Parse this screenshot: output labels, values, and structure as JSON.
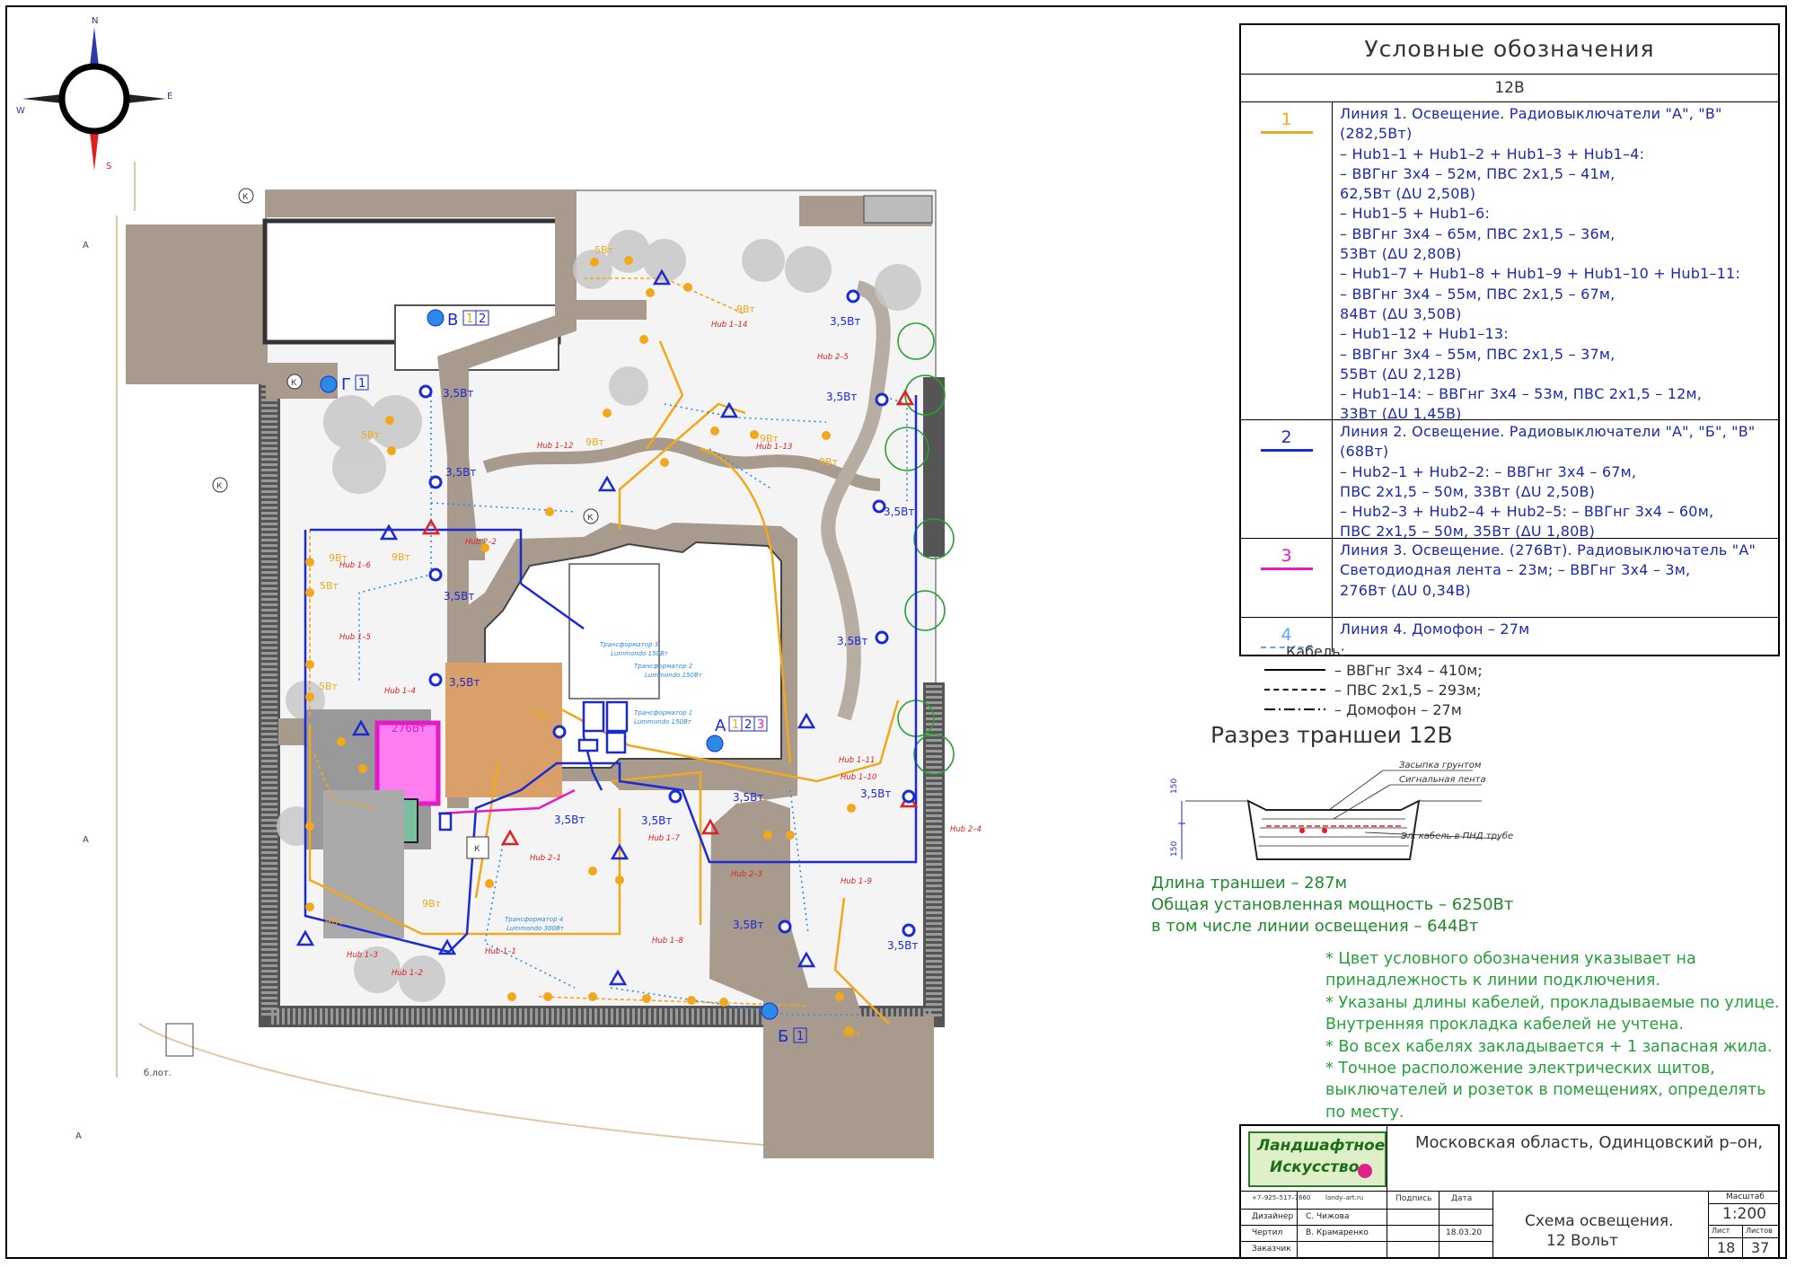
{
  "compass": {
    "n": "N",
    "e": "E",
    "s": "S",
    "w": "W"
  },
  "legend": {
    "title": "Условные обозначения",
    "voltage": "12В",
    "lines": [
      {
        "num": "1",
        "color": "#f2a81d",
        "style": "solid",
        "text": [
          "Линия 1. Освещение. Радиовыключатели \"А\", \"В\"",
          "(282,5Вт)",
          "– Hub1–1 + Hub1–2 + Hub1–3 + Hub1–4:",
          "– ВВГнг 3х4 – 52м, ПВС 2х1,5 – 41м,",
          "   62,5Вт (ΔU 2,50В)",
          "– Hub1–5 + Hub1–6:",
          "– ВВГнг 3х4 – 65м, ПВС 2х1,5 – 36м,",
          "   53Вт (ΔU 2,80В)",
          "– Hub1–7 + Hub1–8 + Hub1–9 + Hub1–10 + Hub1–11:",
          "– ВВГнг 3х4 – 55м, ПВС 2х1,5 – 67м,",
          "   84Вт (ΔU 3,50В)",
          "– Hub1–12 + Hub1–13:",
          "– ВВГнг 3х4 – 55м, ПВС 2х1,5 – 37м,",
          "   55Вт (ΔU 2,12В)",
          "– Hub1–14: – ВВГнг 3х4 – 53м, ПВС 2х1,5 – 12м,",
          "   33Вт (ΔU 1,45В)"
        ]
      },
      {
        "num": "2",
        "color": "#1a2ad6",
        "style": "solid",
        "text": [
          "Линия 2. Освещение. Радиовыключатели \"А\", \"Б\", \"В\"",
          "(68Вт)",
          "– Hub2–1 + Hub2–2: – ВВГнг 3х4 – 67м,",
          "   ПВС 2х1,5 – 50м, 33Вт (ΔU 2,50В)",
          "– Hub2–3 + Hub2–4 + Hub2–5: – ВВГнг 3х4 – 60м,",
          "   ПВС 2х1,5 – 50м, 35Вт (ΔU 1,80В)"
        ]
      },
      {
        "num": "3",
        "color": "#e21ac8",
        "style": "solid",
        "text": [
          "Линия 3. Освещение. (276Вт). Радиовыключатель \"А\"",
          "Светодиодная лента – 23м; – ВВГнг 3х4 – 3м,",
          "276Вт (ΔU 0,34В)"
        ]
      },
      {
        "num": "4",
        "color": "#5aaaf0",
        "style": "dashed",
        "text": [
          "Линия 4. Домофон – 27м"
        ]
      }
    ]
  },
  "cables": {
    "heading": "Кабель:",
    "items": [
      {
        "style": "solid",
        "text": "– ВВГнг 3х4 – 410м;"
      },
      {
        "style": "dashed",
        "text": "– ПВС 2х1,5 – 293м;"
      },
      {
        "style": "dashdot",
        "text": "– Домофон – 27м"
      }
    ]
  },
  "trench": {
    "title": "Разрез траншеи 12В",
    "labels": [
      "Засыпка грунтом",
      "Сигнальная лента",
      "Эл. кабель в ПНД трубе"
    ],
    "dims": [
      "150",
      "150"
    ]
  },
  "stats": [
    "Длина траншеи – 287м",
    "Общая установленная мощность – 6250Вт",
    "в том числе линии освещения – 644Вт"
  ],
  "notes": [
    "* Цвет условного обозначения указывает на",
    "принадлежность к линии подключения.",
    "* Указаны длины кабелей, прокладываемые по улице.",
    "Внутренняя прокладка кабелей не учтена.",
    "* Во всех кабелях закладывается + 1 запасная жила.",
    "* Точное расположение электрических щитов,",
    "выключателей и розеток в помещениях, определять",
    "по месту."
  ],
  "title_block": {
    "logo_line1": "Ландшафтное",
    "logo_line2": "Искусство",
    "address": "Московская область, Одинцовский р–он,",
    "contacts": [
      "+7–925–517–7660",
      "landy–art.ru"
    ],
    "sign_header": "Подпись",
    "date_header": "Дата",
    "roles": [
      {
        "role": "Дизайнер",
        "name": "С. Чижова",
        "date": ""
      },
      {
        "role": "Чертил",
        "name": "В. Крамаренко",
        "date": "18.03.20"
      },
      {
        "role": "Заказчик",
        "name": "",
        "date": ""
      }
    ],
    "sheet_title_1": "Схема освещения.",
    "sheet_title_2": "12 Вольт",
    "scale_label": "Масштаб",
    "scale": "1:200",
    "sheet_label": "Лист",
    "sheets_label": "Листов",
    "sheet": "18",
    "sheets": "37"
  },
  "plan": {
    "switch_labels": [
      {
        "letter": "В",
        "nums": [
          "1",
          "2"
        ]
      },
      {
        "letter": "Г",
        "nums": [
          "1"
        ]
      },
      {
        "letter": "А",
        "nums": [
          "1",
          "2",
          "3"
        ]
      },
      {
        "letter": "Б",
        "nums": [
          "1"
        ]
      }
    ],
    "hubs": [
      "Hub 1–14",
      "Hub 2–5",
      "Hub 1–12",
      "Hub 1–13",
      "Hub 2–2",
      "Hub 1–6",
      "Hub 1–5",
      "Hub 1–4",
      "Hub 2–1",
      "Hub 1–7",
      "Hub 1–11",
      "Hub 1–10",
      "Hub 2–4",
      "Hub 2–3",
      "Hub 1–9",
      "Hub 1–8",
      "Hub 1–3",
      "Hub 1–2",
      "Hub 1–1"
    ],
    "transformers": [
      {
        "name": "Трансформатор 3",
        "model": "Lummondo 150Вт"
      },
      {
        "name": "Трансформатор 2",
        "model": "Lummondo 150Вт"
      },
      {
        "name": "Трансформатор 1",
        "model": "Lummondo 150Вт"
      },
      {
        "name": "Трансформатор 4",
        "model": "Lummondo 300Вт"
      }
    ],
    "power_labels": [
      "5Вт",
      "3,5Вт",
      "9Вт",
      "276Вт"
    ],
    "misc": [
      "К",
      "А",
      "б.лот."
    ]
  },
  "colors": {
    "line1": "#f2a81d",
    "line2": "#1a2ad6",
    "line3": "#e21ac8",
    "line4": "#5aaaf0",
    "paving": "#a89a8c",
    "wall": "#777",
    "hub": "#e02020",
    "note_green": "#23a23a"
  }
}
